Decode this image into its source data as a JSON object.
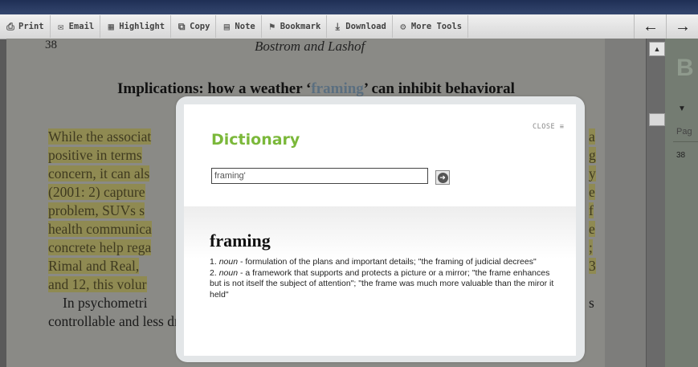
{
  "toolbar": {
    "buttons": [
      {
        "label": "Print",
        "icon": "printer-icon"
      },
      {
        "label": "Email",
        "icon": "email-icon"
      },
      {
        "label": "Highlight",
        "icon": "highlight-icon"
      },
      {
        "label": "Copy",
        "icon": "copy-icon"
      },
      {
        "label": "Note",
        "icon": "note-icon"
      },
      {
        "label": "Bookmark",
        "icon": "bookmark-icon"
      },
      {
        "label": "Download",
        "icon": "download-icon"
      },
      {
        "label": "More Tools",
        "icon": "gear-icon"
      }
    ],
    "back_arrow": "←",
    "forward_arrow": "→"
  },
  "page": {
    "page_number": "38",
    "running_head": "Bostrom and Lashof",
    "heading_pre": "Implications: how a weather ‘",
    "heading_highlight": "framing",
    "heading_post": "’ can inhibit behavioral",
    "lines": [
      {
        "left": "While the associat",
        "right": "a"
      },
      {
        "left": "positive in terms",
        "right": "g"
      },
      {
        "left": "concern, it can als",
        "right": "y"
      },
      {
        "left": "(2001: 2) capture",
        "right": "e"
      },
      {
        "left": "problem, SUVs s",
        "right": "f"
      },
      {
        "left": "health communica",
        "right": "e"
      },
      {
        "left": "concrete help rega",
        "right": ";"
      },
      {
        "left": "Rimal and Real, ",
        "right": "3"
      },
      {
        "left": "and 12, this volur",
        "right": ""
      }
    ],
    "para2_line1_left": "In psychometri",
    "para2_line1_right": "s",
    "para2_line2": "controllable and less dreaded than other risks. These attributes contribute"
  },
  "side_panel": {
    "big_letter": "B",
    "pag_label": "Pag",
    "page_value": "38"
  },
  "dialog": {
    "close_label": "CLOSE",
    "close_icon": "close-icon",
    "title": "Dictionary",
    "search_value": "framing'",
    "go_icon": "go-arrow-icon",
    "headword": "framing",
    "definitions": [
      {
        "num": "1.",
        "pos": "noun",
        "text": " - formulation of the plans and important details; \"the framing of judicial decrees\""
      },
      {
        "num": "2.",
        "pos": "noun",
        "text": " - a framework that supports and protects a picture or a mirror; \"the frame enhances but is not itself the subject of attention\"; \"the frame was much more valuable than the miror it held\""
      }
    ]
  }
}
